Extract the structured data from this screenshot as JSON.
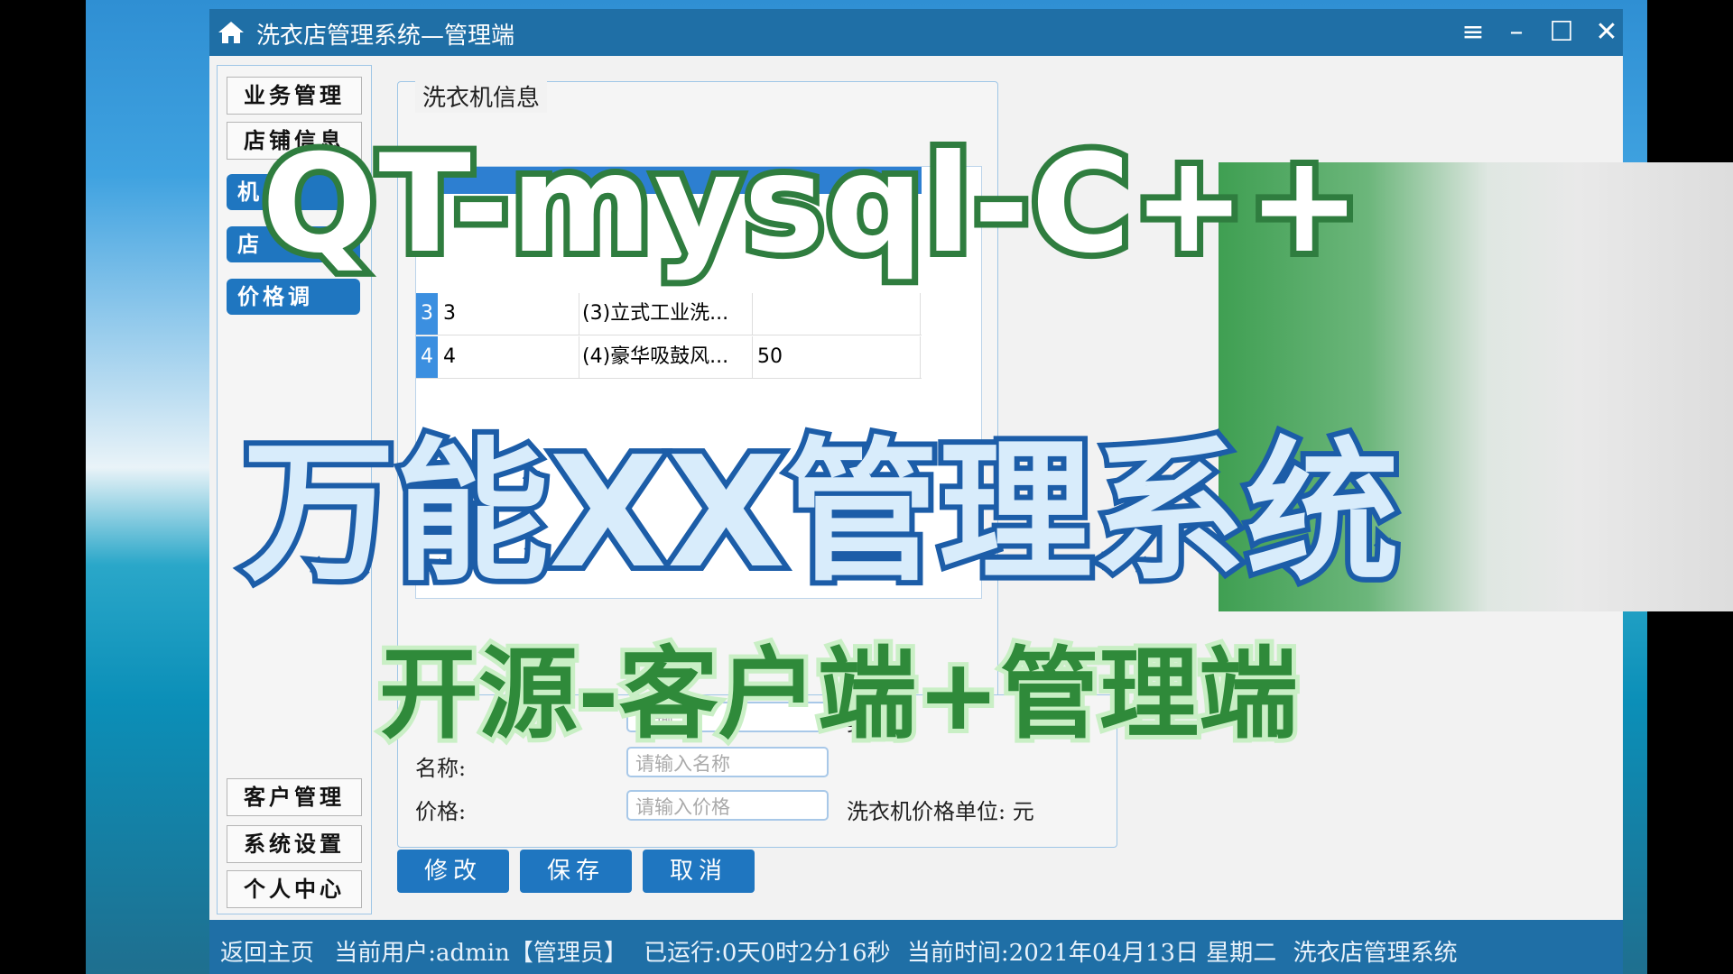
{
  "window": {
    "title": "洗衣店管理系统—管理端"
  },
  "sidebar": {
    "top": [
      "业务管理",
      "店铺信息"
    ],
    "blue": [
      "机",
      "店",
      "价格调"
    ],
    "bottom": [
      "客户管理",
      "系统设置",
      "个人中心"
    ]
  },
  "group": {
    "title": "洗衣机信息"
  },
  "table": {
    "rows": [
      {
        "idx": "3",
        "c1": "3",
        "c2": "(3)立式工业洗...",
        "c3": ""
      },
      {
        "idx": "4",
        "c1": "4",
        "c2": "(4)豪华吸鼓风...",
        "c3": "50"
      }
    ]
  },
  "form": {
    "name_label": "名称:",
    "name_placeholder": "请输入名称",
    "price_label": "价格:",
    "price_placeholder": "请输入价格",
    "unit_text": "洗衣机价格单位: 元",
    "partial_placeholder": "请输",
    "partial_type": "类"
  },
  "actions": {
    "modify": "修改",
    "save": "保存",
    "cancel": "取消"
  },
  "status": {
    "back": "返回主页",
    "user": "当前用户:admin【管理员】",
    "runtime": "已运行:0天0时2分16秒",
    "time": "当前时间:2021年04月13日 星期二",
    "app": "洗衣店管理系统"
  },
  "overlay": {
    "line1": "QT-mysql-C++",
    "line2": "万能XX管理系统",
    "line3": "开源-客户端+管理端"
  },
  "colors": {
    "titlebar": "#1f6fa6",
    "accent": "#1f76c0",
    "overlay_green": "#2f7d3f",
    "overlay_blue": "#1c5da8"
  }
}
